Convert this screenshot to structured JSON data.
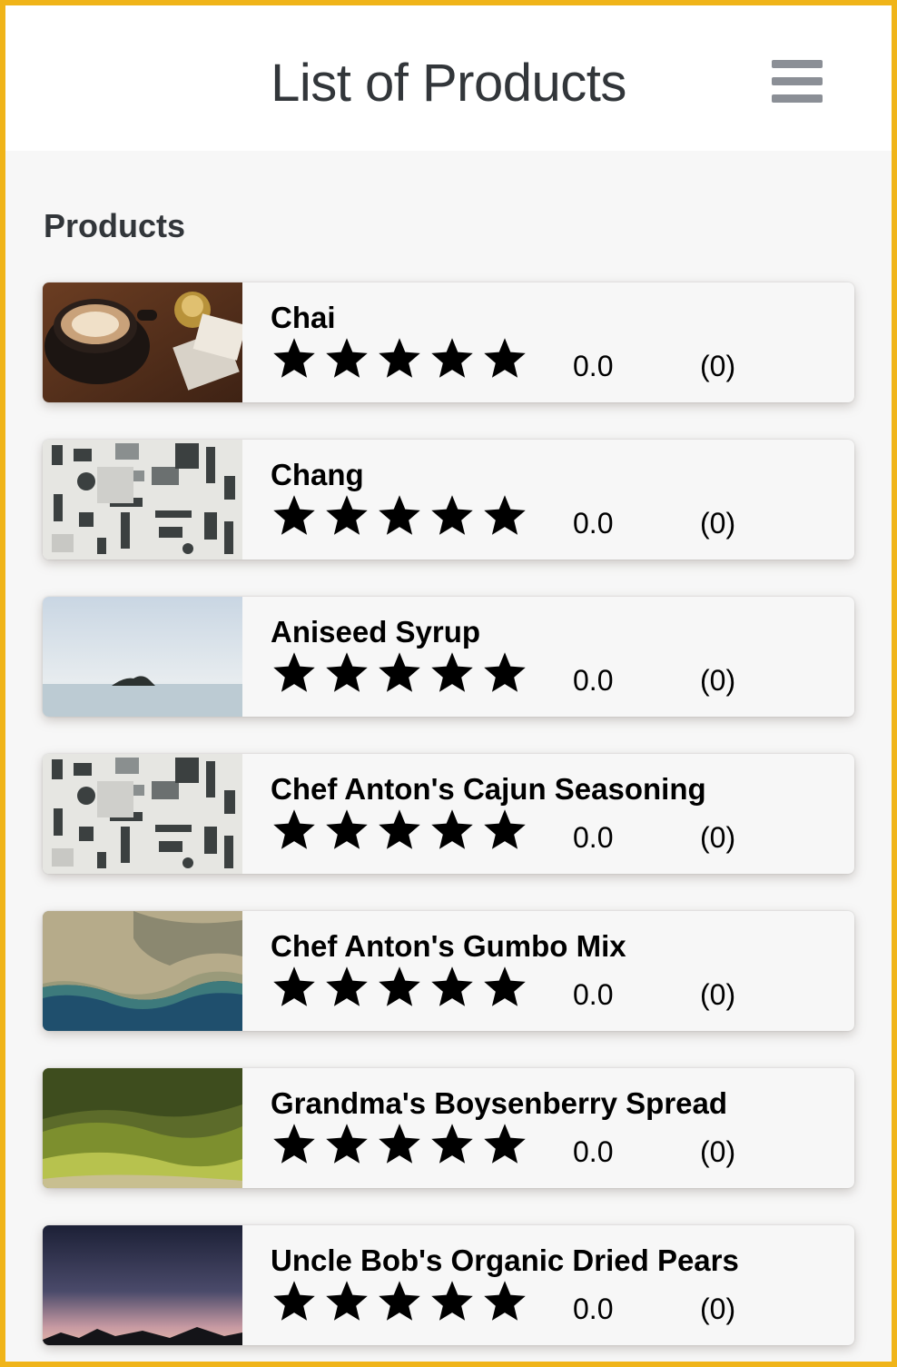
{
  "header": {
    "title": "List of Products",
    "menu_icon": "hamburger-menu-icon"
  },
  "section": {
    "title": "Products"
  },
  "rating_scale": 5,
  "products": [
    {
      "name": "Chai",
      "rating_value": "0.0",
      "rating_count": "(0)",
      "image": "coffee-cup-thumbnail"
    },
    {
      "name": "Chang",
      "rating_value": "0.0",
      "rating_count": "(0)",
      "image": "tools-flatlay-thumbnail"
    },
    {
      "name": "Aniseed Syrup",
      "rating_value": "0.0",
      "rating_count": "(0)",
      "image": "sea-island-thumbnail"
    },
    {
      "name": "Chef Anton's Cajun Seasoning",
      "rating_value": "0.0",
      "rating_count": "(0)",
      "image": "tools-flatlay-thumbnail"
    },
    {
      "name": "Chef Anton's Gumbo Mix",
      "rating_value": "0.0",
      "rating_count": "(0)",
      "image": "coastline-aerial-thumbnail"
    },
    {
      "name": "Grandma's Boysenberry Spread",
      "rating_value": "0.0",
      "rating_count": "(0)",
      "image": "green-hills-thumbnail"
    },
    {
      "name": "Uncle Bob's Organic Dried Pears",
      "rating_value": "0.0",
      "rating_count": "(0)",
      "image": "dusk-horizon-thumbnail"
    }
  ]
}
